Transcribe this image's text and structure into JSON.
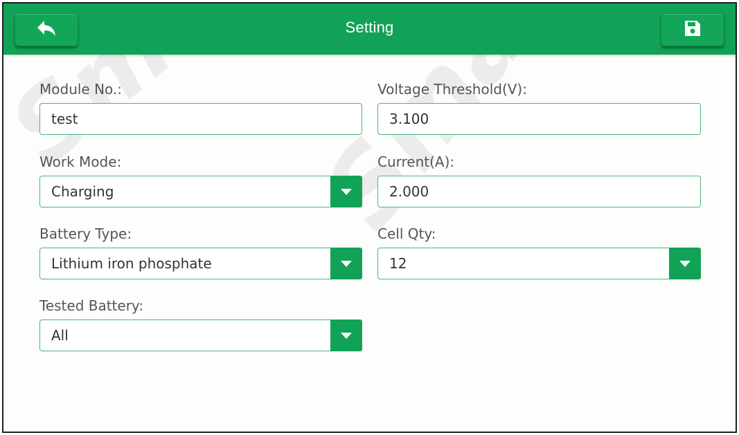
{
  "header": {
    "title": "Setting",
    "back_icon": "back-arrow-icon",
    "save_icon": "save-icon"
  },
  "watermark": {
    "text": "SmartSafe"
  },
  "colors": {
    "header": "#12a257",
    "field_border": "#49b47a",
    "dropdown_button": "#12a257"
  },
  "form": {
    "module_no": {
      "label": "Module No.:",
      "value": "test"
    },
    "voltage_threshold": {
      "label": "Voltage Threshold(V):",
      "value": "3.100"
    },
    "work_mode": {
      "label": "Work Mode:",
      "value": "Charging"
    },
    "current": {
      "label": "Current(A):",
      "value": "2.000"
    },
    "battery_type": {
      "label": "Battery Type:",
      "value": "Lithium iron phosphate"
    },
    "cell_qty": {
      "label": "Cell Qty:",
      "value": "12"
    },
    "tested_battery": {
      "label": "Tested Battery:",
      "value": "All"
    }
  }
}
